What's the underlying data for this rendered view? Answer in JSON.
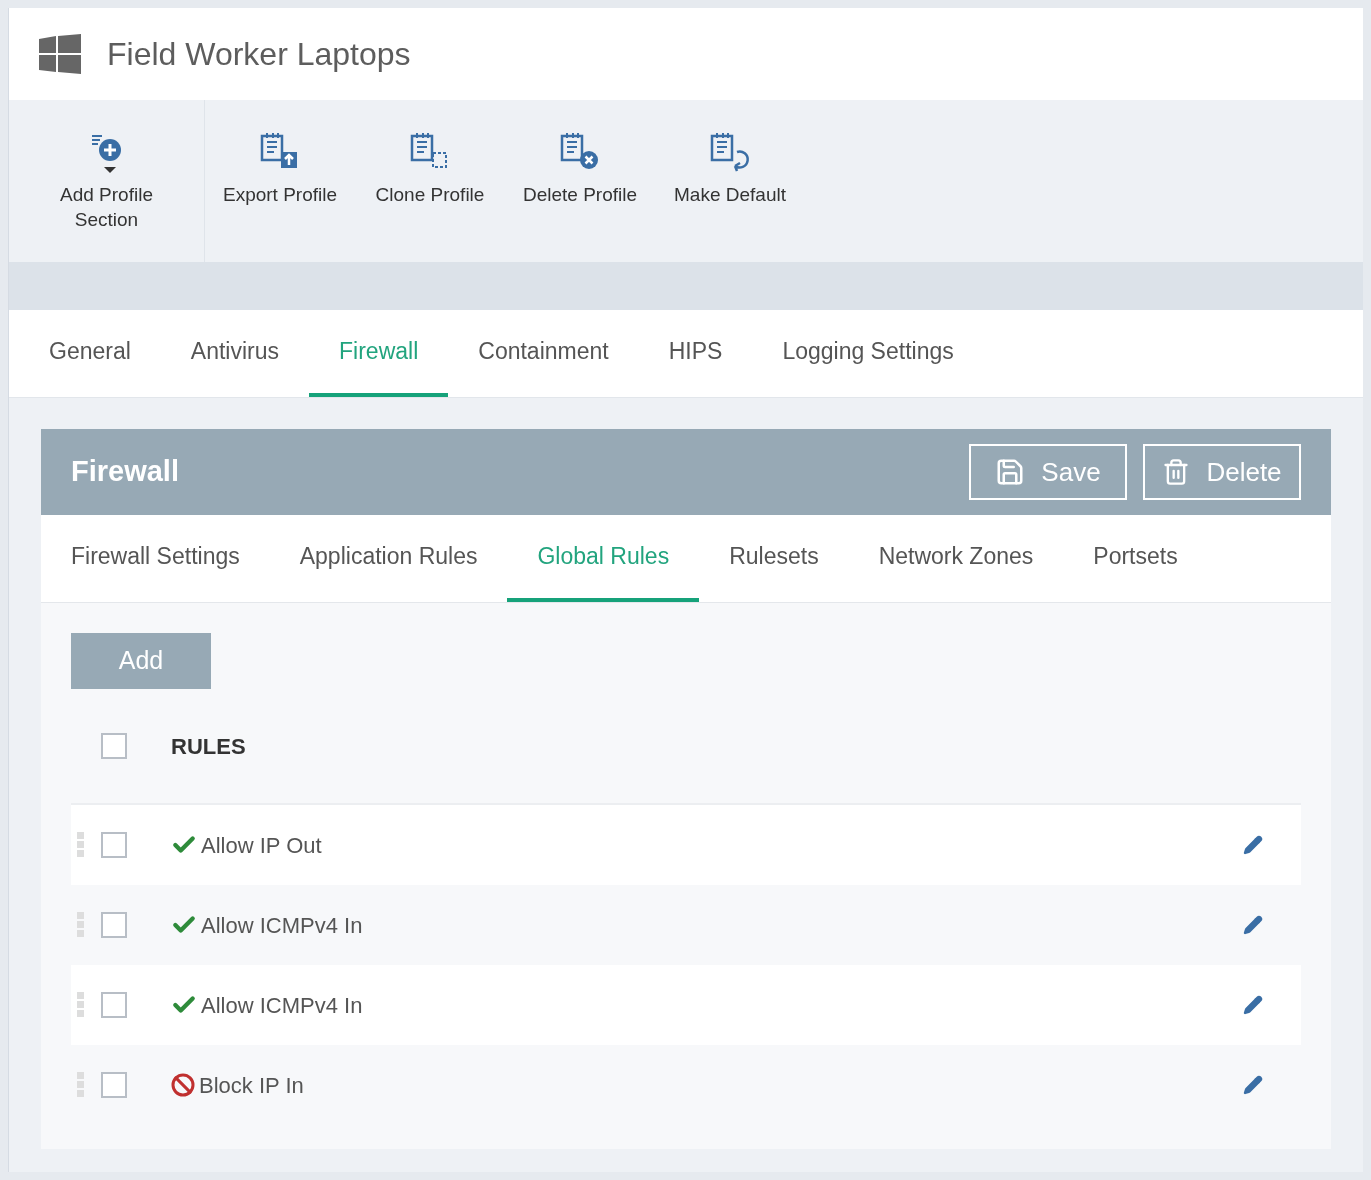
{
  "header": {
    "title": "Field Worker Laptops"
  },
  "toolbar": [
    {
      "kind": "add",
      "label": "Add Profile Section"
    },
    {
      "kind": "export",
      "label": "Export Profile"
    },
    {
      "kind": "clone",
      "label": "Clone Profile"
    },
    {
      "kind": "delete",
      "label": "Delete Profile"
    },
    {
      "kind": "default",
      "label": "Make Default"
    }
  ],
  "tabs": [
    {
      "label": "General",
      "selected": false
    },
    {
      "label": "Antivirus",
      "selected": false
    },
    {
      "label": "Firewall",
      "selected": true
    },
    {
      "label": "Containment",
      "selected": false
    },
    {
      "label": "HIPS",
      "selected": false
    },
    {
      "label": "Logging Settings",
      "selected": false
    }
  ],
  "panel": {
    "title": "Firewall",
    "buttons": [
      {
        "kind": "save",
        "label": "Save"
      },
      {
        "kind": "delete",
        "label": "Delete"
      }
    ],
    "subtabs": [
      {
        "label": "Firewall Settings",
        "selected": false
      },
      {
        "label": "Application Rules",
        "selected": false
      },
      {
        "label": "Global Rules",
        "selected": true
      },
      {
        "label": "Rulesets",
        "selected": false
      },
      {
        "label": "Network Zones",
        "selected": false
      },
      {
        "label": "Portsets",
        "selected": false
      }
    ],
    "add_button": "Add",
    "table": {
      "header": "RULES",
      "header_checked": false,
      "rows": [
        {
          "kind": "allow",
          "name": "Allow IP Out",
          "checked": false
        },
        {
          "kind": "allow",
          "name": "Allow ICMPv4 In",
          "checked": false
        },
        {
          "kind": "allow",
          "name": "Allow ICMPv4 In",
          "checked": false
        },
        {
          "kind": "block",
          "name": "Block IP In",
          "checked": false
        }
      ]
    }
  }
}
